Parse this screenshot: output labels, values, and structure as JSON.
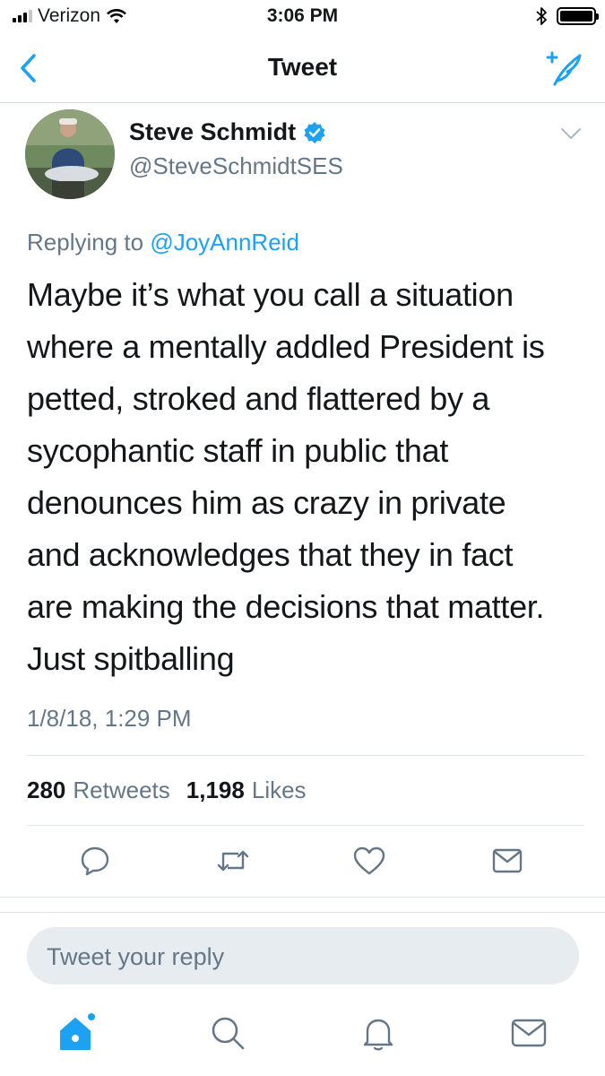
{
  "status_bar": {
    "carrier": "Verizon",
    "time": "3:06 PM",
    "battery_percent": 100
  },
  "nav": {
    "title": "Tweet"
  },
  "tweet": {
    "author_name": "Steve Schmidt",
    "author_handle": "@SteveSchmidtSES",
    "verified": true,
    "replying_label": "Replying to",
    "replying_to": "@JoyAnnReid",
    "text": "Maybe it’s what you call a situation\nwhere a mentally addled President is\npetted, stroked and flattered by a\nsycophantic staff in public that\ndenounces him as crazy in private\nand acknowledges that they in fact\nare making the decisions that matter.\nJust spitballing",
    "timestamp": "1/8/18, 1:29 PM",
    "retweets_count": "280",
    "retweets_label": "Retweets",
    "likes_count": "1,198",
    "likes_label": "Likes"
  },
  "reply": {
    "placeholder": "Tweet your reply"
  },
  "colors": {
    "accent": "#1da1f2",
    "secondary_text": "#657786",
    "icon_gray": "#657786"
  },
  "icons": [
    "back-chevron-icon",
    "compose-tweet-icon",
    "verified-badge-icon",
    "dropdown-caret-icon",
    "reply-icon",
    "retweet-icon",
    "like-icon",
    "share-icon",
    "home-icon",
    "search-icon",
    "notifications-icon",
    "messages-icon"
  ]
}
